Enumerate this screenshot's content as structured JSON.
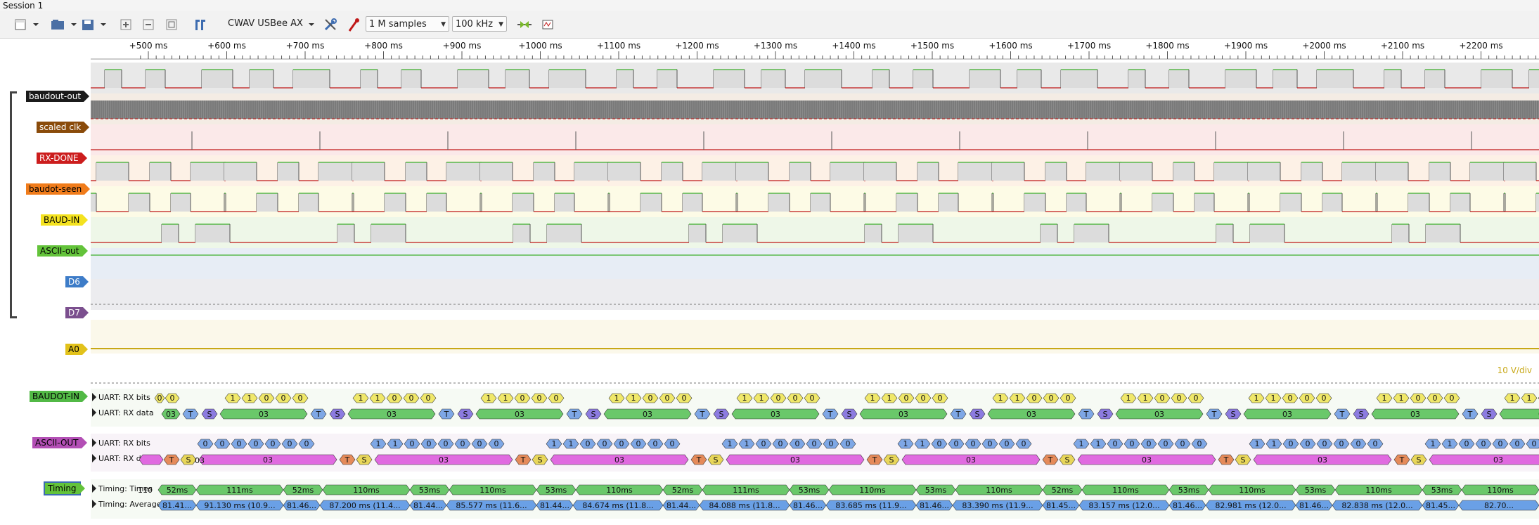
{
  "window": {
    "title": "Session 1"
  },
  "toolbar": {
    "device": "CWAV USBee AX",
    "samples": "1 M samples",
    "samplerate": "100 kHz",
    "icons": [
      "new-session-icon",
      "open-icon",
      "save-icon",
      "zoom-in-icon",
      "zoom-out-icon",
      "zoom-fit-icon",
      "cursor-icon",
      "configure-icon",
      "probe-icon",
      "run-icon",
      "instant-run-icon"
    ]
  },
  "ruler": {
    "ticks": [
      "+500 ms",
      "+600 ms",
      "+700 ms",
      "+800 ms",
      "+900 ms",
      "+1000 ms",
      "+1100 ms",
      "+1200 ms",
      "+1300 ms",
      "+1400 ms",
      "+1500 ms",
      "+1600 ms",
      "+1700 ms",
      "+1800 ms",
      "+1900 ms",
      "+2000 ms",
      "+2100 ms",
      "+2200 ms"
    ]
  },
  "channels": [
    {
      "name": "baudout-out",
      "color": "#1b1b1b",
      "text": "#ffffff",
      "bg": "#e9e9e9"
    },
    {
      "name": "scaled clk",
      "color": "#8a4b0a",
      "text": "#ffffff",
      "bg": "#f4ece4"
    },
    {
      "name": "RX-DONE",
      "color": "#cc1d1d",
      "text": "#ffffff",
      "bg": "#fbe9e9"
    },
    {
      "name": "baudot-seen",
      "color": "#f07c1b",
      "text": "#000000",
      "bg": "#fdf1e6"
    },
    {
      "name": "BAUD-IN",
      "color": "#f4e21f",
      "text": "#000000",
      "bg": "#fdfbe6"
    },
    {
      "name": "ASCII-out",
      "color": "#63c33a",
      "text": "#000000",
      "bg": "#eef7e8"
    },
    {
      "name": "D6",
      "color": "#3d7cc8",
      "text": "#ffffff",
      "bg": "#e7edf5"
    },
    {
      "name": "D7",
      "color": "#7b4f8e",
      "text": "#ffffff",
      "bg": "#ececef"
    }
  ],
  "analog": {
    "name": "A0",
    "color": "#e2c21b",
    "scale": "10 V/div"
  },
  "decoders": [
    {
      "name": "BAUDOT-IN",
      "color": "#52b946",
      "rows": [
        "UART: RX bits",
        "UART: RX data"
      ]
    },
    {
      "name": "ASCII-OUT",
      "color": "#b34fb5",
      "rows": [
        "UART: RX bits",
        "UART: RX data"
      ]
    },
    {
      "name": "Timing",
      "color": "#63c33a",
      "rows": [
        "Timing: Times",
        "Timing: Averages"
      ]
    }
  ],
  "baudot": {
    "first_bits": [
      "0",
      "0"
    ],
    "bits": [
      "1",
      "1",
      "0",
      "0",
      "0"
    ],
    "data_first": "03",
    "data": "03",
    "start": "S",
    "stop": "T"
  },
  "ascii": {
    "first_bits": [
      "0",
      "0",
      "0",
      "0",
      "0",
      "0",
      "0"
    ],
    "bits": [
      "1",
      "1",
      "0",
      "0",
      "0",
      "0",
      "0",
      "0"
    ],
    "data": "03",
    "start": "S",
    "stop": "T"
  },
  "timing": {
    "times": [
      "110",
      "52ms",
      "111ms",
      "52ms",
      "110ms",
      "53ms",
      "110ms",
      "53ms",
      "110ms",
      "52ms",
      "111ms",
      "53ms",
      "110ms",
      "53ms",
      "110ms",
      "52ms",
      "110ms",
      "53ms",
      "110ms",
      "53ms",
      "110ms",
      "53ms",
      "110ms",
      "53ms",
      "110ms"
    ],
    "averages": [
      "81.41...",
      "91.130 ms (10.9...",
      "81.46...",
      "87.200 ms (11.4...",
      "81.44...",
      "85.577 ms (11.6...",
      "81.44...",
      "84.674 ms (11.8...",
      "81.44...",
      "84.088 ms (11.8...",
      "81.46...",
      "83.685 ms (11.9...",
      "81.46...",
      "83.390 ms (11.9...",
      "81.45...",
      "83.157 ms (12.0...",
      "81.46...",
      "82.981 ms (12.0...",
      "81.46...",
      "82.838 ms (12.0...",
      "81.45...",
      "82.70..."
    ]
  },
  "colors": {
    "high_line": "#3dae2b",
    "low_line": "#c01818",
    "grid": "#cccccc"
  }
}
